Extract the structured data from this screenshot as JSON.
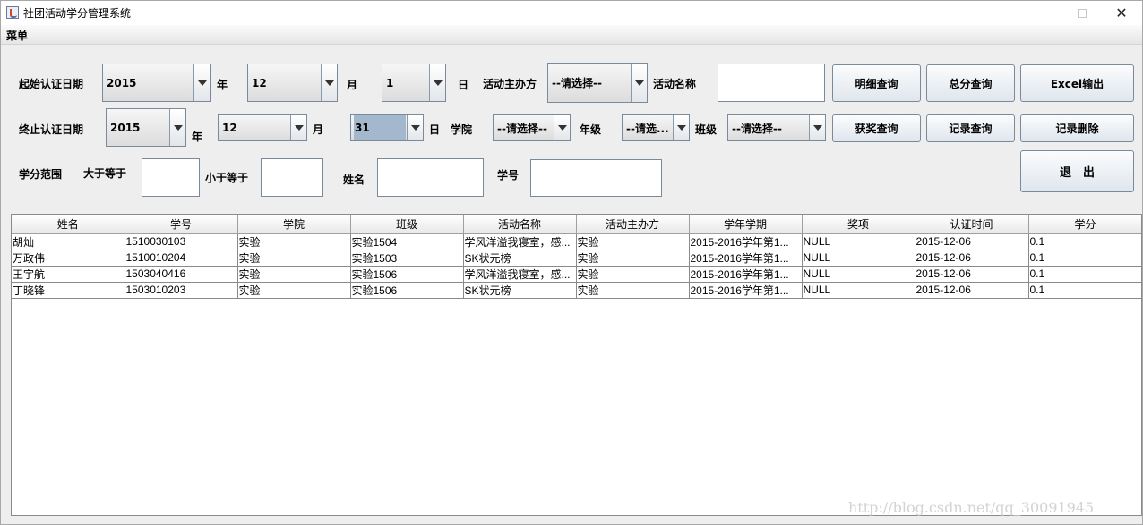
{
  "window": {
    "title": "社团活动学分管理系统",
    "controls": {
      "minimize": "—",
      "maximize": "☐",
      "close": "✕"
    }
  },
  "menu": {
    "label": "菜单"
  },
  "filters": {
    "start_label": "起始认证日期",
    "start_year": "2015",
    "year_label": "年",
    "start_month": "12",
    "month_label": "月",
    "start_day": "1",
    "day_label": "日",
    "host_label": "活动主办方",
    "host_value": "--请选择--",
    "activity_label": "活动名称",
    "activity_value": "",
    "end_label": "终止认证日期",
    "end_year": "2015",
    "end_month": "12",
    "end_day": "31",
    "college_label": "学院",
    "college_value": "--请选择--",
    "grade_label": "年级",
    "grade_value": "--请选...",
    "class_label": "班级",
    "class_value": "--请选择--",
    "range_label": "学分范围",
    "gte_label": "大于等于",
    "gte_value": "",
    "lte_label": "小于等于",
    "lte_value": "",
    "name_label": "姓名",
    "name_value": "",
    "id_label": "学号",
    "id_value": ""
  },
  "buttons": {
    "detail_query": "明细查询",
    "total_query": "总分查询",
    "excel_export": "Excel输出",
    "award_query": "获奖查询",
    "record_query": "记录查询",
    "record_delete": "记录删除",
    "exit": "退　出"
  },
  "table": {
    "columns": [
      "姓名",
      "学号",
      "学院",
      "班级",
      "活动名称",
      "活动主办方",
      "学年学期",
      "奖项",
      "认证时间",
      "学分"
    ],
    "rows": [
      [
        "胡灿",
        "1510030103",
        "实验",
        "实验1504",
        "学风洋溢我寝室，感...",
        "实验",
        "2015-2016学年第1...",
        "NULL",
        "2015-12-06",
        "0.1"
      ],
      [
        "万政伟",
        "1510010204",
        "实验",
        "实验1503",
        "SK状元榜",
        "实验",
        "2015-2016学年第1...",
        "NULL",
        "2015-12-06",
        "0.1"
      ],
      [
        "王宇航",
        "1503040416",
        "实验",
        "实验1506",
        "学风洋溢我寝室，感...",
        "实验",
        "2015-2016学年第1...",
        "NULL",
        "2015-12-06",
        "0.1"
      ],
      [
        "丁晓锋",
        "1503010203",
        "实验",
        "实验1506",
        "SK状元榜",
        "实验",
        "2015-2016学年第1...",
        "NULL",
        "2015-12-06",
        "0.1"
      ]
    ]
  },
  "watermark": "http://blog.csdn.net/qq_30091945"
}
